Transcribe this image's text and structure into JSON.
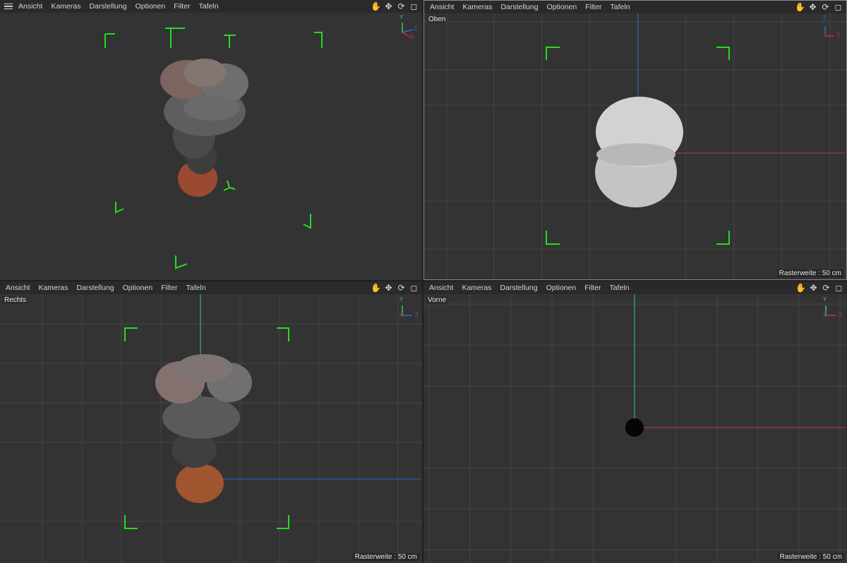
{
  "menu": {
    "items": [
      "Ansicht",
      "Kameras",
      "Darstellung",
      "Optionen",
      "Filter",
      "Tafeln"
    ]
  },
  "nav_icons": [
    "hand-pan-icon",
    "move-arrows-icon",
    "rotate-icon",
    "maximize-icon"
  ],
  "viewports": {
    "perspective": {
      "label": ""
    },
    "top": {
      "label": "Oben",
      "raster": "Rasterweite : 50 cm"
    },
    "right": {
      "label": "Rechts",
      "raster": "Rasterweite : 50 cm"
    },
    "front": {
      "label": "Vorne",
      "raster": "Rasterweite : 50 cm"
    }
  },
  "axes": {
    "perspective": {
      "a": "Y",
      "b": "Z",
      "c": "X"
    },
    "top": {
      "a": "Z",
      "b": "X"
    },
    "right": {
      "a": "Y",
      "b": "Z",
      "c": "X"
    },
    "front": {
      "a": "Y",
      "b": "X",
      "c": "Z"
    }
  },
  "colors": {
    "viewport_bg": "#333333",
    "grid": "#444444",
    "safe_frame": "#22dd22",
    "axis_x": "#cc3333",
    "axis_y": "#33cc66",
    "axis_z": "#3366cc"
  }
}
